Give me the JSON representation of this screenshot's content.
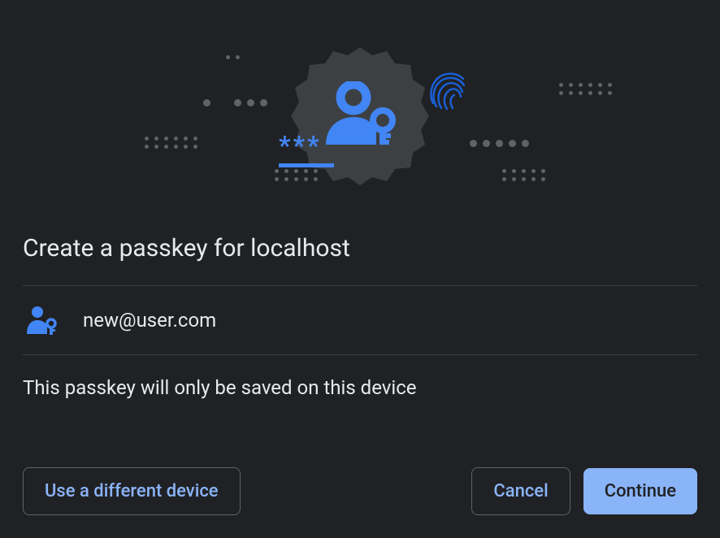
{
  "title": "Create a passkey for localhost",
  "user": {
    "email": "new@user.com"
  },
  "description": "This passkey will only be saved on this device",
  "buttons": {
    "use_different_device": "Use a different device",
    "cancel": "Cancel",
    "continue": "Continue"
  },
  "colors": {
    "accent": "#4285f4",
    "link": "#8ab4f8",
    "bg": "#202124",
    "text": "#e8eaed",
    "muted": "#5f6368",
    "divider": "#3c4043"
  }
}
